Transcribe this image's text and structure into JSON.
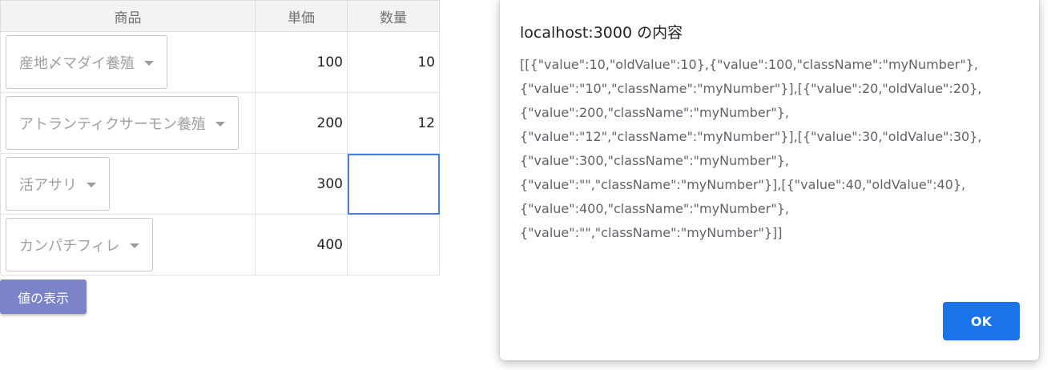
{
  "grid": {
    "headers": {
      "product": "商品",
      "price": "単価",
      "qty": "数量"
    },
    "rows": [
      {
        "product": "産地〆マダイ養殖",
        "price": "100",
        "qty": "10"
      },
      {
        "product": "アトランティクサーモン養殖",
        "price": "200",
        "qty": "12"
      },
      {
        "product": "活アサリ",
        "price": "300",
        "qty": ""
      },
      {
        "product": "カンパチフィレ",
        "price": "400",
        "qty": ""
      }
    ]
  },
  "button": {
    "show_values": "値の表示"
  },
  "dialog": {
    "title": "localhost:3000 の内容",
    "lines": [
      "[[{\"value\":10,\"oldValue\":10},{\"value\":100,\"className\":\"myNumber\"},",
      "{\"value\":\"10\",\"className\":\"myNumber\"}],[{\"value\":20,\"oldValue\":20},",
      "{\"value\":200,\"className\":\"myNumber\"},",
      "{\"value\":\"12\",\"className\":\"myNumber\"}],[{\"value\":30,\"oldValue\":30},",
      "{\"value\":300,\"className\":\"myNumber\"},",
      "{\"value\":\"\",\"className\":\"myNumber\"}],[{\"value\":40,\"oldValue\":40},",
      "{\"value\":400,\"className\":\"myNumber\"},",
      "{\"value\":\"\",\"className\":\"myNumber\"}]]"
    ],
    "ok_label": "OK"
  },
  "colors": {
    "button_bg": "#7b84c8",
    "ok_bg": "#1a73e8",
    "selection_border": "#4a80d8"
  }
}
